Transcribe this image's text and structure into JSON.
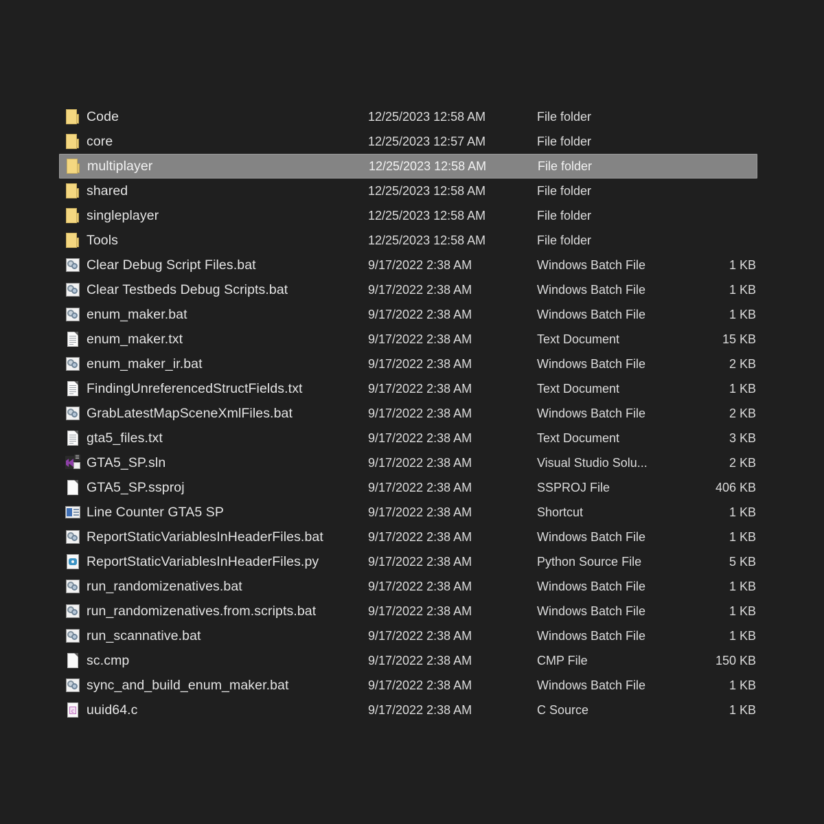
{
  "view": {
    "background_color": "#1f1f1f",
    "selection_color": "#848484",
    "text_color": "#e4e4e4",
    "folder_color": "#f4d780"
  },
  "rows": [
    {
      "name": "Code",
      "date": "12/25/2023 12:58 AM",
      "type": "File folder",
      "size": "",
      "icon": "folder-icon",
      "selected": false
    },
    {
      "name": "core",
      "date": "12/25/2023 12:57 AM",
      "type": "File folder",
      "size": "",
      "icon": "folder-icon",
      "selected": false
    },
    {
      "name": "multiplayer",
      "date": "12/25/2023 12:58 AM",
      "type": "File folder",
      "size": "",
      "icon": "folder-icon",
      "selected": true
    },
    {
      "name": "shared",
      "date": "12/25/2023 12:58 AM",
      "type": "File folder",
      "size": "",
      "icon": "folder-icon",
      "selected": false
    },
    {
      "name": "singleplayer",
      "date": "12/25/2023 12:58 AM",
      "type": "File folder",
      "size": "",
      "icon": "folder-icon",
      "selected": false
    },
    {
      "name": "Tools",
      "date": "12/25/2023 12:58 AM",
      "type": "File folder",
      "size": "",
      "icon": "folder-icon",
      "selected": false
    },
    {
      "name": "Clear Debug Script Files.bat",
      "date": "9/17/2022 2:38 AM",
      "type": "Windows Batch File",
      "size": "1 KB",
      "icon": "batch-file-icon",
      "selected": false
    },
    {
      "name": "Clear Testbeds Debug Scripts.bat",
      "date": "9/17/2022 2:38 AM",
      "type": "Windows Batch File",
      "size": "1 KB",
      "icon": "batch-file-icon",
      "selected": false
    },
    {
      "name": "enum_maker.bat",
      "date": "9/17/2022 2:38 AM",
      "type": "Windows Batch File",
      "size": "1 KB",
      "icon": "batch-file-icon",
      "selected": false
    },
    {
      "name": "enum_maker.txt",
      "date": "9/17/2022 2:38 AM",
      "type": "Text Document",
      "size": "15 KB",
      "icon": "text-document-icon",
      "selected": false
    },
    {
      "name": "enum_maker_ir.bat",
      "date": "9/17/2022 2:38 AM",
      "type": "Windows Batch File",
      "size": "2 KB",
      "icon": "batch-file-icon",
      "selected": false
    },
    {
      "name": "FindingUnreferencedStructFields.txt",
      "date": "9/17/2022 2:38 AM",
      "type": "Text Document",
      "size": "1 KB",
      "icon": "text-document-icon",
      "selected": false
    },
    {
      "name": "GrabLatestMapSceneXmlFiles.bat",
      "date": "9/17/2022 2:38 AM",
      "type": "Windows Batch File",
      "size": "2 KB",
      "icon": "batch-file-icon",
      "selected": false
    },
    {
      "name": "gta5_files.txt",
      "date": "9/17/2022 2:38 AM",
      "type": "Text Document",
      "size": "3 KB",
      "icon": "text-document-icon",
      "selected": false
    },
    {
      "name": "GTA5_SP.sln",
      "date": "9/17/2022 2:38 AM",
      "type": "Visual Studio Solu...",
      "size": "2 KB",
      "icon": "visual-studio-solution-icon",
      "selected": false
    },
    {
      "name": "GTA5_SP.ssproj",
      "date": "9/17/2022 2:38 AM",
      "type": "SSPROJ File",
      "size": "406 KB",
      "icon": "blank-page-icon",
      "selected": false
    },
    {
      "name": "Line Counter GTA5 SP",
      "date": "9/17/2022 2:38 AM",
      "type": "Shortcut",
      "size": "1 KB",
      "icon": "shortcut-icon",
      "selected": false
    },
    {
      "name": "ReportStaticVariablesInHeaderFiles.bat",
      "date": "9/17/2022 2:38 AM",
      "type": "Windows Batch File",
      "size": "1 KB",
      "icon": "batch-file-icon",
      "selected": false
    },
    {
      "name": "ReportStaticVariablesInHeaderFiles.py",
      "date": "9/17/2022 2:38 AM",
      "type": "Python Source File",
      "size": "5 KB",
      "icon": "python-file-icon",
      "selected": false
    },
    {
      "name": "run_randomizenatives.bat",
      "date": "9/17/2022 2:38 AM",
      "type": "Windows Batch File",
      "size": "1 KB",
      "icon": "batch-file-icon",
      "selected": false
    },
    {
      "name": "run_randomizenatives.from.scripts.bat",
      "date": "9/17/2022 2:38 AM",
      "type": "Windows Batch File",
      "size": "1 KB",
      "icon": "batch-file-icon",
      "selected": false
    },
    {
      "name": "run_scannative.bat",
      "date": "9/17/2022 2:38 AM",
      "type": "Windows Batch File",
      "size": "1 KB",
      "icon": "batch-file-icon",
      "selected": false
    },
    {
      "name": "sc.cmp",
      "date": "9/17/2022 2:38 AM",
      "type": "CMP File",
      "size": "150 KB",
      "icon": "blank-page-icon",
      "selected": false
    },
    {
      "name": "sync_and_build_enum_maker.bat",
      "date": "9/17/2022 2:38 AM",
      "type": "Windows Batch File",
      "size": "1 KB",
      "icon": "batch-file-icon",
      "selected": false
    },
    {
      "name": "uuid64.c",
      "date": "9/17/2022 2:38 AM",
      "type": "C Source",
      "size": "1 KB",
      "icon": "c-source-icon",
      "selected": false
    }
  ],
  "icon_glyphs": {
    "visual_studio_badge": "☰"
  }
}
